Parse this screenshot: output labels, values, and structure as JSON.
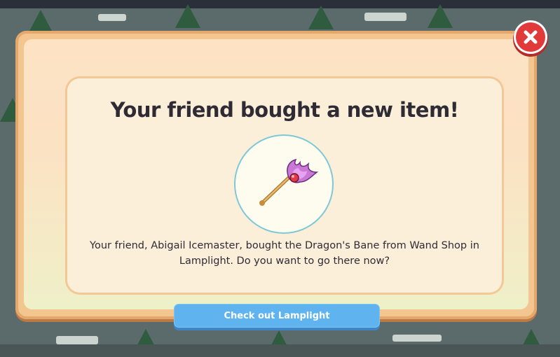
{
  "dialog": {
    "title": "Your friend bought a new item!",
    "message": "Your friend, Abigail Icemaster, bought the Dragon's Bane from Wand Shop in Lamplight. Do you want to go there now?",
    "cta_label": "Check out Lamplight",
    "item_icon": "dragons-bane-wand-icon",
    "close_icon": "close-icon"
  },
  "colors": {
    "frame": "#f3c58f",
    "panel": "#fcefd9",
    "button": "#5fb4f0",
    "close": "#e03a3a",
    "text": "#2e2b35"
  }
}
